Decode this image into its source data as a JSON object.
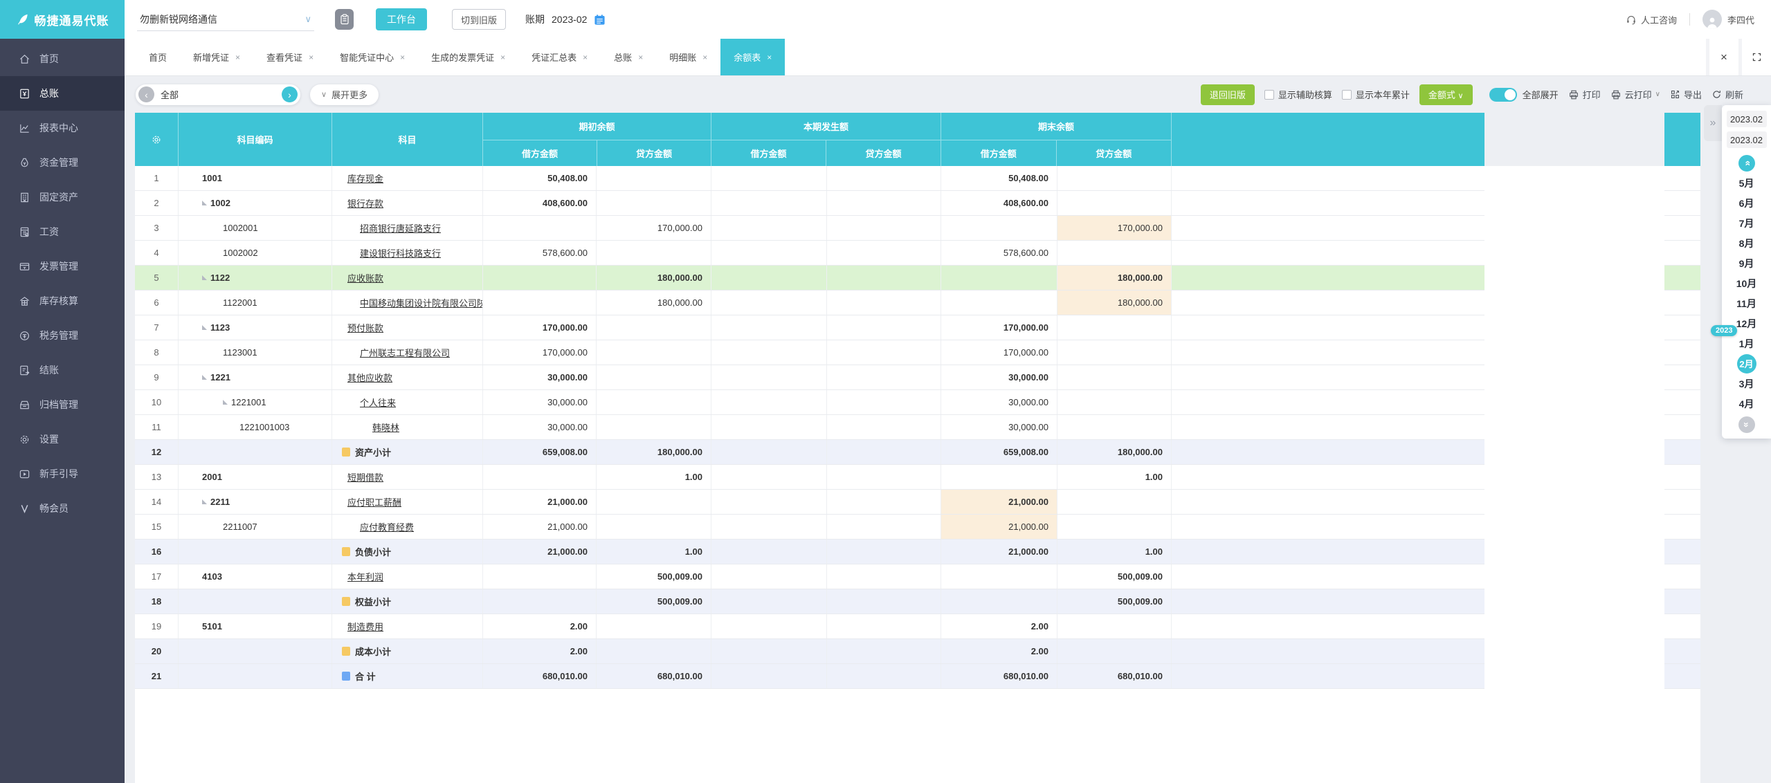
{
  "topbar": {
    "logo_text": "畅捷通易代账",
    "company": "勿删新锐网络通信",
    "workbench_label": "工作台",
    "switch_old_label": "切到旧版",
    "period_label": "账期",
    "period_value": "2023-02",
    "consult_label": "人工咨询",
    "user_name": "李四代"
  },
  "sidebar": {
    "items": [
      {
        "label": "首页",
        "icon": "home-icon"
      },
      {
        "label": "总账",
        "icon": "ledger-icon",
        "active": true
      },
      {
        "label": "报表中心",
        "icon": "report-icon"
      },
      {
        "label": "资金管理",
        "icon": "fund-icon"
      },
      {
        "label": "固定资产",
        "icon": "asset-icon"
      },
      {
        "label": "工资",
        "icon": "salary-icon"
      },
      {
        "label": "发票管理",
        "icon": "invoice-icon"
      },
      {
        "label": "库存核算",
        "icon": "inventory-icon"
      },
      {
        "label": "税务管理",
        "icon": "tax-icon"
      },
      {
        "label": "结账",
        "icon": "closing-icon"
      },
      {
        "label": "归档管理",
        "icon": "archive-icon"
      },
      {
        "label": "设置",
        "icon": "settings-icon"
      },
      {
        "label": "新手引导",
        "icon": "guide-icon"
      },
      {
        "label": "畅会员",
        "icon": "member-icon"
      }
    ]
  },
  "tabs": {
    "items": [
      {
        "label": "首页",
        "closable": false
      },
      {
        "label": "新增凭证",
        "closable": true
      },
      {
        "label": "查看凭证",
        "closable": true
      },
      {
        "label": "智能凭证中心",
        "closable": true
      },
      {
        "label": "生成的发票凭证",
        "closable": true
      },
      {
        "label": "凭证汇总表",
        "closable": true
      },
      {
        "label": "总账",
        "closable": true
      },
      {
        "label": "明细账",
        "closable": true
      },
      {
        "label": "余额表",
        "closable": true,
        "active": true
      }
    ]
  },
  "toolbar": {
    "filter_value": "全部",
    "expand_more_label": "展开更多",
    "back_old_label": "退回旧版",
    "checkbox_aux_label": "显示辅助核算",
    "checkbox_ytd_label": "显示本年累计",
    "amount_style_label": "金额式",
    "expand_all_label": "全部展开",
    "print_label": "打印",
    "cloud_print_label": "云打印",
    "export_label": "导出",
    "refresh_label": "刷新"
  },
  "table": {
    "header": {
      "code": "科目编码",
      "subject": "科目",
      "debit": "借方金额",
      "credit": "贷方金额",
      "groups": [
        {
          "label": "期初余额"
        },
        {
          "label": "本期发生额"
        },
        {
          "label": "期末余额"
        }
      ]
    },
    "rows": [
      {
        "num": "1",
        "code": "1001",
        "lvl": 1,
        "subj": "库存现金",
        "bold": true,
        "qc_j": "50,408.00",
        "qm_j": "50,408.00"
      },
      {
        "num": "2",
        "code": "1002",
        "lvl": 1,
        "exp": true,
        "subj": "银行存款",
        "bold": true,
        "qc_j": "408,600.00",
        "qm_j": "408,600.00"
      },
      {
        "num": "3",
        "code": "1002001",
        "lvl": 2,
        "subj": "招商银行唐延路支行",
        "qc_d": "170,000.00",
        "qm_d": "170,000.00",
        "hl": [
          "qm_d"
        ]
      },
      {
        "num": "4",
        "code": "1002002",
        "lvl": 2,
        "subj": "建设银行科技路支行",
        "qc_j": "578,600.00",
        "qm_j": "578,600.00"
      },
      {
        "num": "5",
        "code": "1122",
        "lvl": 1,
        "exp": true,
        "subj": "应收账款",
        "type": "sel",
        "bold": true,
        "qc_d": "180,000.00",
        "qm_d": "180,000.00",
        "hl": [
          "qm_d"
        ]
      },
      {
        "num": "6",
        "code": "1122001",
        "lvl": 2,
        "subj": "中国移动集团设计院有限公司陕",
        "qc_d": "180,000.00",
        "qm_d": "180,000.00",
        "hl": [
          "qm_d"
        ]
      },
      {
        "num": "7",
        "code": "1123",
        "lvl": 1,
        "exp": true,
        "subj": "预付账款",
        "bold": true,
        "qc_j": "170,000.00",
        "qm_j": "170,000.00"
      },
      {
        "num": "8",
        "code": "1123001",
        "lvl": 2,
        "subj": "广州联志工程有限公司",
        "qc_j": "170,000.00",
        "qm_j": "170,000.00"
      },
      {
        "num": "9",
        "code": "1221",
        "lvl": 1,
        "exp": true,
        "subj": "其他应收款",
        "bold": true,
        "qc_j": "30,000.00",
        "qm_j": "30,000.00"
      },
      {
        "num": "10",
        "code": "1221001",
        "lvl": 2,
        "exp": true,
        "subj": "个人往来",
        "qc_j": "30,000.00",
        "qm_j": "30,000.00"
      },
      {
        "num": "11",
        "code": "1221001003",
        "lvl": 3,
        "subj": "韩晓林",
        "qc_j": "30,000.00",
        "qm_j": "30,000.00"
      },
      {
        "num": "12",
        "type": "sub",
        "icon": "yellow",
        "subj": "资产小计",
        "bold": true,
        "qc_j": "659,008.00",
        "qc_d": "180,000.00",
        "qm_j": "659,008.00",
        "qm_d": "180,000.00"
      },
      {
        "num": "13",
        "code": "2001",
        "lvl": 1,
        "subj": "短期借款",
        "bold": true,
        "qc_d": "1.00",
        "qm_d": "1.00"
      },
      {
        "num": "14",
        "code": "2211",
        "lvl": 1,
        "exp": true,
        "subj": "应付职工薪酬",
        "bold": true,
        "qc_j": "21,000.00",
        "qm_j": "21,000.00",
        "hl": [
          "qm_j"
        ]
      },
      {
        "num": "15",
        "code": "2211007",
        "lvl": 2,
        "subj": "应付教育经费",
        "qc_j": "21,000.00",
        "qm_j": "21,000.00",
        "hl": [
          "qm_j"
        ]
      },
      {
        "num": "16",
        "type": "sub",
        "icon": "yellow",
        "subj": "负债小计",
        "bold": true,
        "qc_j": "21,000.00",
        "qc_d": "1.00",
        "qm_j": "21,000.00",
        "qm_d": "1.00"
      },
      {
        "num": "17",
        "code": "4103",
        "lvl": 1,
        "subj": "本年利润",
        "bold": true,
        "qc_d": "500,009.00",
        "qm_d": "500,009.00"
      },
      {
        "num": "18",
        "type": "sub",
        "icon": "yellow",
        "subj": "权益小计",
        "bold": true,
        "qc_d": "500,009.00",
        "qm_d": "500,009.00"
      },
      {
        "num": "19",
        "code": "5101",
        "lvl": 1,
        "subj": "制造费用",
        "bold": true,
        "qc_j": "2.00",
        "qm_j": "2.00"
      },
      {
        "num": "20",
        "type": "sub",
        "icon": "yellow",
        "subj": "成本小计",
        "bold": true,
        "qc_j": "2.00",
        "qm_j": "2.00"
      },
      {
        "num": "21",
        "type": "total",
        "icon": "blue",
        "subj": "合 计",
        "bold": true,
        "qc_j": "680,010.00",
        "qc_d": "680,010.00",
        "qm_j": "680,010.00",
        "qm_d": "680,010.00"
      }
    ]
  },
  "side_panel": {
    "period_from": "2023.02",
    "period_to": "2023.02",
    "year_badge": "2023",
    "months": [
      "5月",
      "6月",
      "7月",
      "8月",
      "9月",
      "10月",
      "11月",
      "12月",
      "1月",
      "2月",
      "3月",
      "4月"
    ],
    "selected_month": "2月"
  },
  "ui": {
    "close_glyph": "×",
    "chevron_left": "‹",
    "chevron_right": "›",
    "chevron_down": "∨",
    "double_chevron": "»"
  },
  "colors": {
    "brand_cyan": "#3EC4D6",
    "sidebar_bg": "#3F4458",
    "green_button": "#8FC53C",
    "selected_row_green": "#DCF3D2",
    "subtotal_row_blue": "#EEF1FA",
    "highlight_cell_orange": "#FBEEDB"
  }
}
